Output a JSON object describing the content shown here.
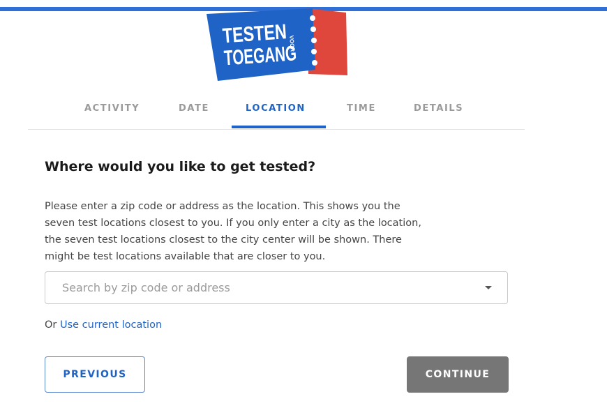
{
  "logo": {
    "line1": "TESTEN",
    "small": "VOOR",
    "line2": "TOEGANG",
    "colors": {
      "ticket_blue": "#1f63c7",
      "ticket_red": "#e0473c",
      "text": "#ffffff"
    }
  },
  "steps": [
    {
      "label": "ACTIVITY",
      "active": false
    },
    {
      "label": "DATE",
      "active": false
    },
    {
      "label": "LOCATION",
      "active": true
    },
    {
      "label": "TIME",
      "active": false
    },
    {
      "label": "DETAILS",
      "active": false
    }
  ],
  "main": {
    "heading": "Where would you like to get tested?",
    "description_lines": [
      "Please enter a zip code or address as the location. This shows you the",
      "seven test locations closest to you. If you only enter a city as the location,",
      "the seven test locations closest to the city center will be shown. There",
      "might be test locations available that are closer to you."
    ],
    "search": {
      "placeholder": "Search by zip code or address",
      "value": "",
      "icon": "chevron-down-icon"
    },
    "alt_prefix": "Or",
    "alt_link": "Use current location"
  },
  "buttons": {
    "previous": "PREVIOUS",
    "continue": "CONTINUE"
  },
  "colors": {
    "accent": "#1f63c7",
    "top_bar": "#2f6fd6",
    "continue_bg": "#767676",
    "inactive_step": "#9a9a9a"
  }
}
